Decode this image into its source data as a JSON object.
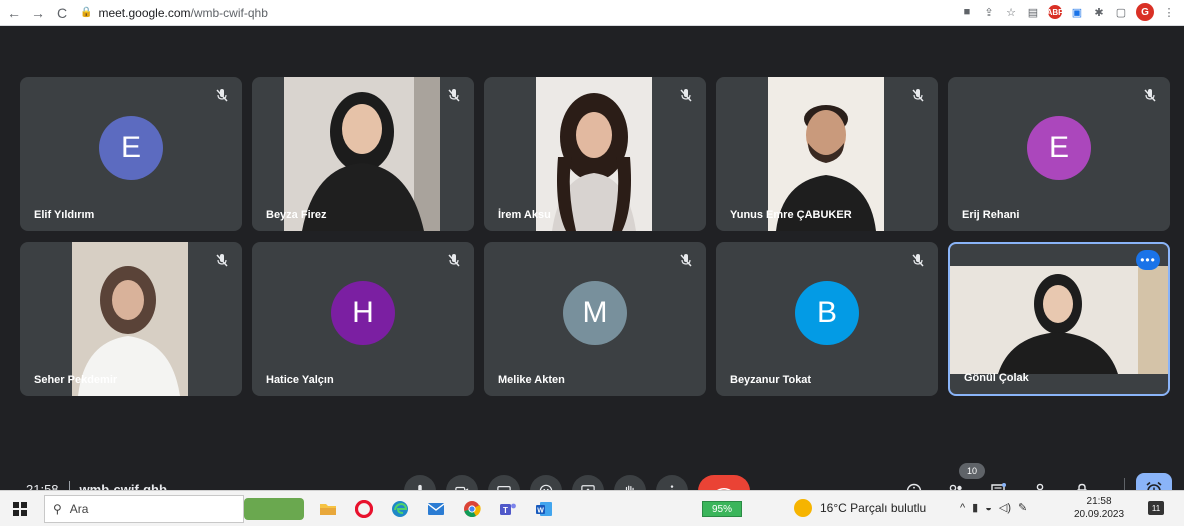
{
  "browser": {
    "url_domain": "meet.google.com",
    "url_path": "/wmb-cwif-qhb",
    "profile_initial": "G",
    "ext_abp": "ABP"
  },
  "participants": [
    {
      "name": "Elif Yıldırım",
      "initial": "E",
      "avatar_color": "#5c6bc0",
      "video": false
    },
    {
      "name": "Beyza Firez",
      "video": true
    },
    {
      "name": "İrem Aksu",
      "video": true
    },
    {
      "name": "Yunus Emre ÇABUKER",
      "video": true
    },
    {
      "name": "Erij Rehani",
      "initial": "E",
      "avatar_color": "#ab47bc",
      "video": false
    },
    {
      "name": "Seher Pekdemir",
      "video": true
    },
    {
      "name": "Hatice Yalçın",
      "initial": "H",
      "avatar_color": "#7b1fa2",
      "video": false
    },
    {
      "name": "Melike Akten",
      "initial": "M",
      "avatar_color": "#78909c",
      "video": false
    },
    {
      "name": "Beyzanur Tokat",
      "initial": "B",
      "avatar_color": "#039be5",
      "video": false
    },
    {
      "name": "Gönül Çolak",
      "video": true,
      "active": true
    }
  ],
  "meeting": {
    "time": "21:58",
    "code": "wmb-cwif-qhb",
    "participant_count": "10"
  },
  "taskbar": {
    "search_placeholder": "Ara",
    "battery": "95%",
    "weather": "16°C  Parçalı bulutlu",
    "clock_time": "21:58",
    "clock_date": "20.09.2023",
    "notification_count": "11"
  },
  "colors": {
    "stage_bg": "#202124",
    "tile_bg": "#3c4043",
    "end_call": "#ea4335",
    "accent": "#8ab4f8"
  }
}
